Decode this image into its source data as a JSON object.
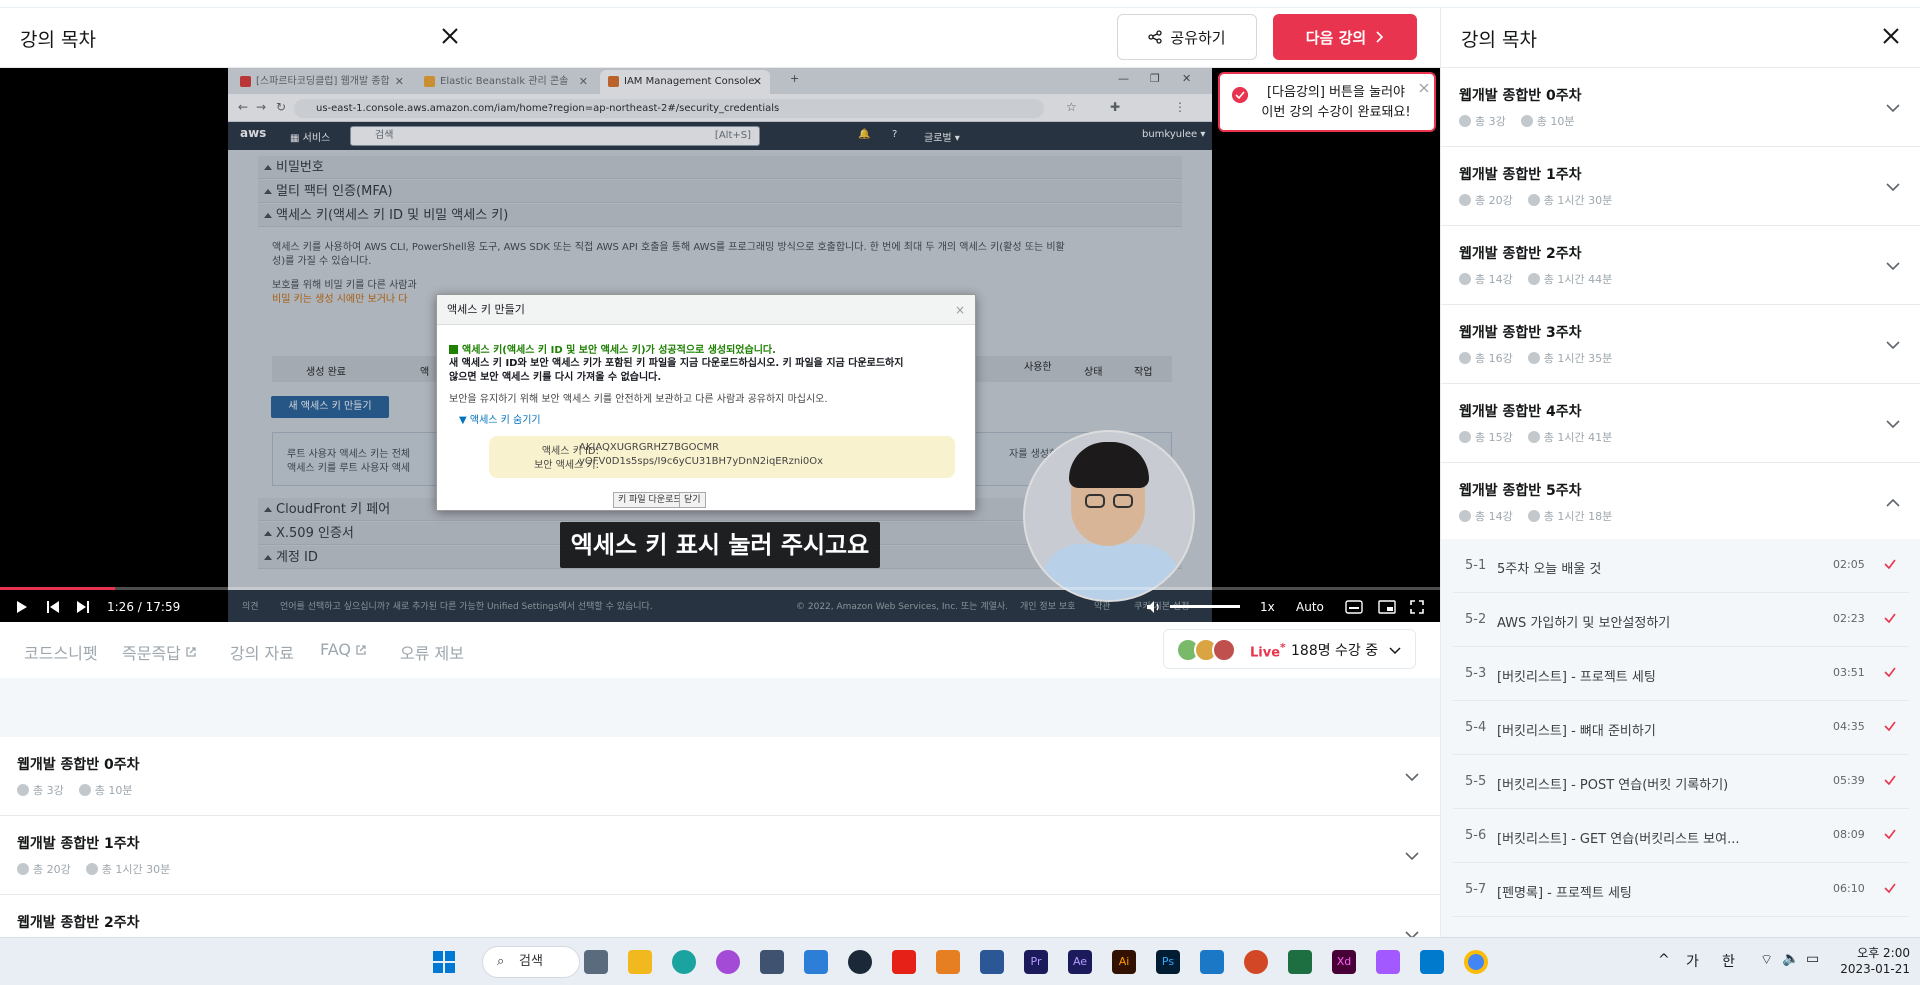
{
  "header": {
    "title": "강의 목차",
    "share_label": "공유하기",
    "next_label": "다음 강의"
  },
  "toast": {
    "line1": "[다음강의] 버튼을 눌러야",
    "line2": "이번 강의 수강이 완료돼요!"
  },
  "browser": {
    "tabs": [
      "[스파르타코딩클럽] 웹개발 종합",
      "Elastic Beanstalk 관리 콘솔",
      "IAM Management Console"
    ],
    "url": "us-east-1.console.aws.amazon.com/iam/home?region=ap-northeast-2#/security_credentials"
  },
  "aws": {
    "logo": "aws",
    "services": "서비스",
    "search_placeholder": "검색",
    "search_kbd": "[Alt+S]",
    "region": "글로벌 ▾",
    "user": "bumkyulee ▾"
  },
  "iam": {
    "sections": [
      "비밀번호",
      "멀티 팩터 인증(MFA)",
      "액세스 키(액세스 키 ID 및 비밀 액세스 키)",
      "CloudFront 키 페어",
      "X.509 인증서",
      "계정 ID"
    ],
    "desc1": "액세스 키를 사용하여 AWS CLI, PowerShell용 도구, AWS SDK 또는 직접 AWS API 호출을 통해 AWS를 프로그래밍 방식으로 호출합니다. 한 번에 최대 두 개의 액세스 키(활성 또는 비활",
    "desc1b": "성)를 가질 수 있습니다.",
    "desc2": "보호를 위해 비밀 키를 다른 사람과",
    "desc3": "비밀 키는 생성 시에만 보거나 다",
    "col_created": "생성 완료",
    "col_access": "액",
    "col_last_used": "사용한",
    "col_status": "상태",
    "col_action": "작업",
    "new_key_btn": "새 액세스 키 만들기",
    "root1": "루트 사용자 액세스 키는 전체",
    "root2": "액세스 키를 루트 사용자 액세",
    "root_right": "자를 생성하고",
    "footer_left": "의견",
    "footer_mid": "언어를 선택하고 싶으십니까? 새로 추가된 다른 가능한 Unified Settings에서 선택할 수 있습니다.",
    "footer_copy": "© 2022, Amazon Web Services, Inc. 또는 계열사.",
    "footer_privacy": "개인 정보 보호",
    "footer_terms": "약관",
    "footer_cookie": "쿠키 기본 설정"
  },
  "modal": {
    "title": "액세스 키 만들기",
    "success": "액세스 키(액세스 키 ID 및 보안 액세스 키)가 성공적으로 생성되었습니다.",
    "line1": "새 액세스 키 ID와 보안 액세스 키가 포함된 키 파일을 지금 다운로드하십시오. 키 파일을 지금 다운로드하지",
    "line2": "않으면 보안 액세스 키를 다시 가져올 수 없습니다.",
    "line3": "보안을 유지하기 위해 보안 액세스 키를 안전하게 보관하고 다른 사람과 공유하지 마십시오.",
    "hide_toggle": "▼ 액세스 키 숨기기",
    "key_id_label": "액세스 키 ID:",
    "key_id": "AKIAQXUGRGRHZ7BGOCMR",
    "secret_label": "보안 액세스 키:",
    "secret": "yOFV0D1s5sps/I9c6yCU31BH7yDnN2iqERzni0Ox",
    "download_btn": "키 파일 다운로드",
    "close_btn": "닫기"
  },
  "player": {
    "subtitle": "엑세스 키 표시 눌러 주시고요",
    "current": "1:26",
    "separator": "/",
    "duration": "17:59",
    "progress": 0.0797,
    "speed": "1x",
    "quality": "Auto"
  },
  "lecture_tabs": [
    "코드스니펫",
    "즉문즉답",
    "강의 자료",
    "FAQ",
    "오류 제보"
  ],
  "live": {
    "label": "Live",
    "asterisk": "*",
    "count": "188명 수강 중"
  },
  "weeks": [
    {
      "title": "웹개발 종합반 0주차",
      "count": "총 3강",
      "time": "총 10분"
    },
    {
      "title": "웹개발 종합반 1주차",
      "count": "총 20강",
      "time": "총 1시간 30분"
    },
    {
      "title": "웹개발 종합반 2주차",
      "count": "총 14강",
      "time": "총 1시간 44분"
    },
    {
      "title": "웹개발 종합반 3주차",
      "count": "총 16강",
      "time": "총 1시간 35분"
    },
    {
      "title": "웹개발 종합반 4주차",
      "count": "총 15강",
      "time": "총 1시간 41분"
    },
    {
      "title": "웹개발 종합반 5주차",
      "count": "총 14강",
      "time": "총 1시간 18분"
    }
  ],
  "right_panel": {
    "title": "강의 목차"
  },
  "lessons": [
    {
      "num": "5-1",
      "title": "5주차 오늘 배울 것",
      "dur": "02:05"
    },
    {
      "num": "5-2",
      "title": "AWS 가입하기 및 보안설정하기",
      "dur": "02:23"
    },
    {
      "num": "5-3",
      "title": "[버킷리스트] - 프로젝트 세팅",
      "dur": "03:51"
    },
    {
      "num": "5-4",
      "title": "[버킷리스트] - 뼈대 준비하기",
      "dur": "04:35"
    },
    {
      "num": "5-5",
      "title": "[버킷리스트] - POST 연습(버킷 기록하기)",
      "dur": "05:39"
    },
    {
      "num": "5-6",
      "title": "[버킷리스트] - GET 연습(버킷리스트 보여...",
      "dur": "08:09"
    },
    {
      "num": "5-7",
      "title": "[펜명록] - 프로젝트 세팅",
      "dur": "06:10"
    }
  ],
  "taskbar": {
    "search": "검색",
    "ime1": "가",
    "ime2": "한",
    "time": "오후 2:00",
    "date": "2023-01-21"
  },
  "colors": {
    "accent": "#e8344e",
    "aws_bar": "#232f3e"
  }
}
